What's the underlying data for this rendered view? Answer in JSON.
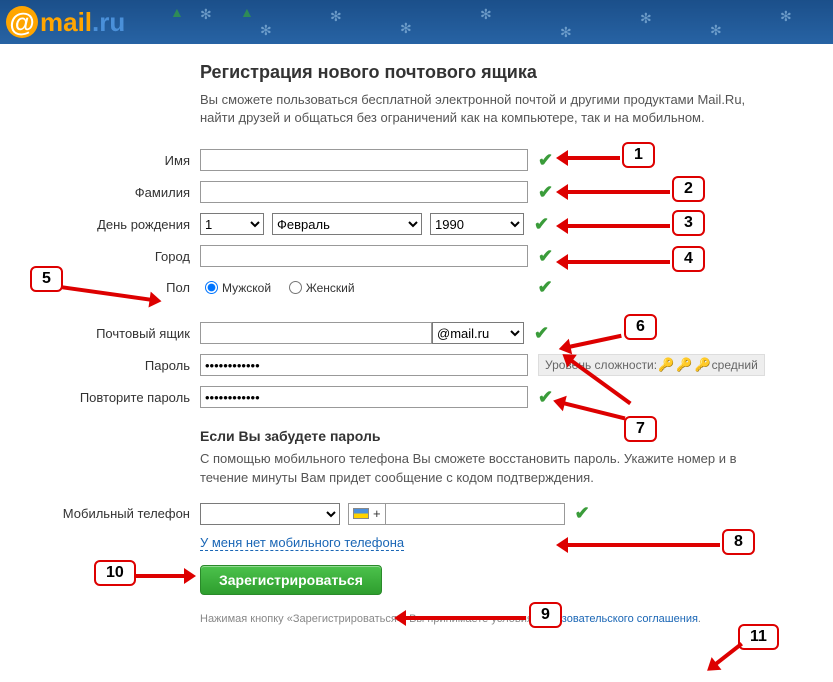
{
  "logo": {
    "at": "@",
    "text1": "mail",
    "text2": ".ru"
  },
  "title": "Регистрация нового почтового ящика",
  "intro": "Вы сможете пользоваться бесплатной электронной почтой и другими продуктами Mail.Ru, найти друзей и общаться без ограничений как на компьютере, так и на мобильном.",
  "labels": {
    "firstname": "Имя",
    "lastname": "Фамилия",
    "birthday": "День рождения",
    "city": "Город",
    "gender": "Пол",
    "mailbox": "Почтовый ящик",
    "password": "Пароль",
    "password2": "Повторите пароль",
    "phone": "Мобильный телефон"
  },
  "birthday": {
    "day": "1",
    "month": "Февраль",
    "year": "1990"
  },
  "gender": {
    "male": "Мужской",
    "female": "Женский"
  },
  "mailbox": {
    "domain": "@mail.ru"
  },
  "password_strength": {
    "label": "Уровень сложности:",
    "value": "средний"
  },
  "forgot": {
    "heading": "Если Вы забудете пароль",
    "text": "С помощью мобильного телефона Вы сможете восстановить пароль. Укажите номер и в течение минуты Вам придет сообщение с кодом подтверждения."
  },
  "phone": {
    "prefix": "+",
    "placeholder": ""
  },
  "no_phone_link": "У меня нет мобильного телефона",
  "submit": "Зарегистрироваться",
  "legal": {
    "pre": "Нажимая кнопку «Зарегистрироваться», Вы принимаете условия ",
    "link": "Пользовательского соглашения",
    "post": "."
  },
  "annotations": {
    "1": "1",
    "2": "2",
    "3": "3",
    "4": "4",
    "5": "5",
    "6": "6",
    "7": "7",
    "8": "8",
    "9": "9",
    "10": "10",
    "11": "11"
  }
}
